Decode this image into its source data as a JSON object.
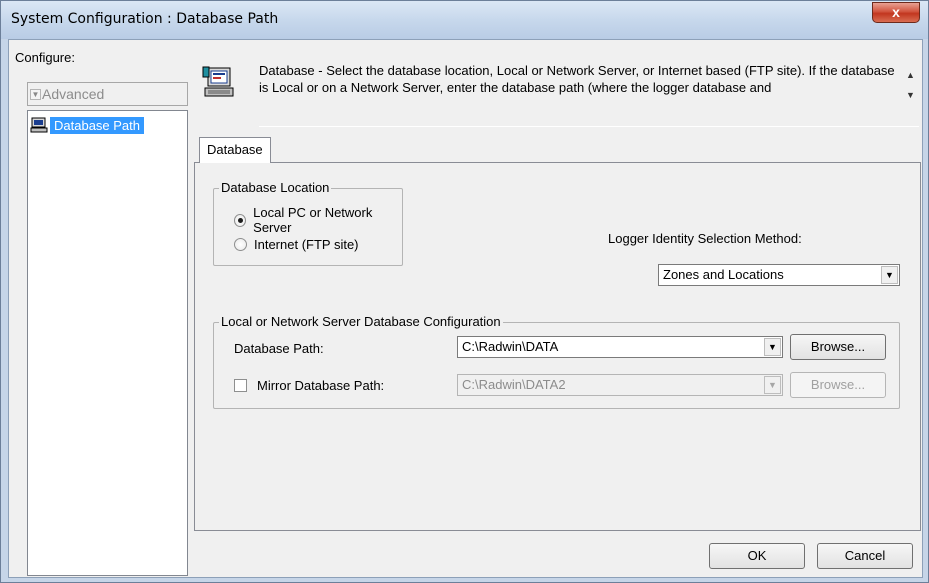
{
  "window": {
    "title": "System Configuration : Database Path",
    "close_glyph": "x"
  },
  "left_panel": {
    "configure_label": "Configure:",
    "dropdown": {
      "value": "Advanced",
      "arrow_glyph": "▼"
    },
    "tree": {
      "items": [
        {
          "label": "Database Path",
          "icon": "computer-icon",
          "selected": true
        }
      ]
    }
  },
  "description": {
    "text": "Database - Select the database location, Local or Network Server, or Internet based (FTP site). If the database is Local or on a Network Server, enter the database path (where the logger database and",
    "scroll_up_glyph": "▲",
    "scroll_down_glyph": "▼"
  },
  "tab": {
    "label": "Database"
  },
  "database_location": {
    "legend": "Database Location",
    "options": [
      {
        "label": "Local PC or Network Server",
        "checked": true
      },
      {
        "label": "Internet (FTP site)",
        "checked": false
      }
    ]
  },
  "logger_identity": {
    "label": "Logger Identity Selection Method:",
    "value": "Zones and Locations",
    "arrow_glyph": "▼"
  },
  "local_config": {
    "legend": "Local or Network Server Database Configuration",
    "database_path": {
      "label": "Database Path:",
      "value": "C:\\Radwin\\DATA",
      "arrow_glyph": "▼",
      "browse_label": "Browse..."
    },
    "mirror_path": {
      "label": "Mirror Database Path:",
      "checked": false,
      "value": "C:\\Radwin\\DATA2",
      "arrow_glyph": "▼",
      "browse_label": "Browse..."
    }
  },
  "footer": {
    "ok_label": "OK",
    "cancel_label": "Cancel"
  },
  "colors": {
    "selection": "#3399ff",
    "close_button": "#c2361f",
    "dialog_background": "#f0f0f0"
  }
}
